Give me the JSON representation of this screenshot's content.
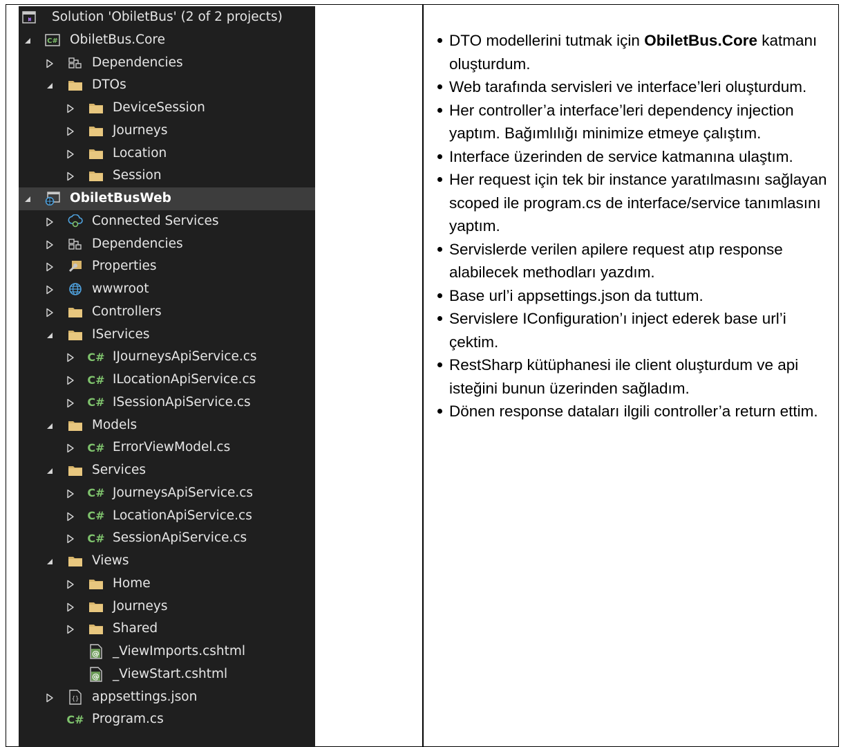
{
  "solution_explorer": {
    "items": [
      {
        "label": "Solution 'ObiletBus' (2 of 2 projects)",
        "icon": "solution-icon",
        "expand": "none"
      },
      {
        "label": "ObiletBus.Core",
        "icon": "csharp-project-icon",
        "expand": "expanded"
      },
      {
        "label": "Dependencies",
        "icon": "dependencies-icon",
        "expand": "collapsed"
      },
      {
        "label": "DTOs",
        "icon": "folder-icon",
        "expand": "expanded"
      },
      {
        "label": "DeviceSession",
        "icon": "folder-icon",
        "expand": "collapsed"
      },
      {
        "label": "Journeys",
        "icon": "folder-icon",
        "expand": "collapsed"
      },
      {
        "label": "Location",
        "icon": "folder-icon",
        "expand": "collapsed"
      },
      {
        "label": "Session",
        "icon": "folder-icon",
        "expand": "collapsed"
      },
      {
        "label": "ObiletBusWeb",
        "icon": "web-project-icon",
        "expand": "expanded",
        "selected": true
      },
      {
        "label": "Connected Services",
        "icon": "connected-services-icon",
        "expand": "collapsed"
      },
      {
        "label": "Dependencies",
        "icon": "dependencies-icon",
        "expand": "collapsed"
      },
      {
        "label": "Properties",
        "icon": "properties-icon",
        "expand": "collapsed"
      },
      {
        "label": "wwwroot",
        "icon": "globe-icon",
        "expand": "collapsed"
      },
      {
        "label": "Controllers",
        "icon": "folder-icon",
        "expand": "collapsed"
      },
      {
        "label": "IServices",
        "icon": "folder-icon",
        "expand": "expanded"
      },
      {
        "label": "IJourneysApiService.cs",
        "icon": "csharp-file-icon",
        "expand": "collapsed"
      },
      {
        "label": "ILocationApiService.cs",
        "icon": "csharp-file-icon",
        "expand": "collapsed"
      },
      {
        "label": "ISessionApiService.cs",
        "icon": "csharp-file-icon",
        "expand": "collapsed"
      },
      {
        "label": "Models",
        "icon": "folder-icon",
        "expand": "expanded"
      },
      {
        "label": "ErrorViewModel.cs",
        "icon": "csharp-file-icon",
        "expand": "collapsed"
      },
      {
        "label": "Services",
        "icon": "folder-icon",
        "expand": "expanded"
      },
      {
        "label": "JourneysApiService.cs",
        "icon": "csharp-file-icon",
        "expand": "collapsed"
      },
      {
        "label": "LocationApiService.cs",
        "icon": "csharp-file-icon",
        "expand": "collapsed"
      },
      {
        "label": "SessionApiService.cs",
        "icon": "csharp-file-icon",
        "expand": "collapsed"
      },
      {
        "label": "Views",
        "icon": "folder-icon",
        "expand": "expanded"
      },
      {
        "label": "Home",
        "icon": "folder-icon",
        "expand": "collapsed"
      },
      {
        "label": "Journeys",
        "icon": "folder-icon",
        "expand": "collapsed"
      },
      {
        "label": "Shared",
        "icon": "folder-icon",
        "expand": "collapsed"
      },
      {
        "label": "_ViewImports.cshtml",
        "icon": "razor-file-icon",
        "expand": "none"
      },
      {
        "label": "_ViewStart.cshtml",
        "icon": "razor-file-icon",
        "expand": "none"
      },
      {
        "label": "appsettings.json",
        "icon": "json-file-icon",
        "expand": "collapsed"
      },
      {
        "label": "Program.cs",
        "icon": "csharp-file-icon",
        "expand": "none"
      }
    ],
    "csharp_glyph": "C#"
  },
  "notes": {
    "items": [
      {
        "before": "DTO modellerini tutmak için ",
        "bold": "ObiletBus.Core",
        "after": " katmanı oluşturdum."
      },
      {
        "before": "Web tarafında servisleri ve interface’leri oluşturdum.",
        "bold": "",
        "after": ""
      },
      {
        "before": "Her controller’a interface’leri dependency injection yaptım. Bağımlılığı minimize etmeye çalıştım.",
        "bold": "",
        "after": ""
      },
      {
        "before": "Interface üzerinden de service katmanına ulaştım.",
        "bold": "",
        "after": ""
      },
      {
        "before": "Her request için tek bir instance yaratılmasını sağlayan scoped ile program.cs de interface/service tanımlasını yaptım.",
        "bold": "",
        "after": ""
      },
      {
        "before": "Servislerde verilen apilere request atıp response alabilecek methodları yazdım.",
        "bold": "",
        "after": ""
      },
      {
        "before": "Base url’i appsettings.json da tuttum.",
        "bold": "",
        "after": ""
      },
      {
        "before": "Servislere IConfiguration’ı inject ederek base url’i çektim.",
        "bold": "",
        "after": ""
      },
      {
        "before": "RestSharp kütüphanesi ile client oluşturdum ve api isteğini bunun üzerinden sağladım.",
        "bold": "",
        "after": ""
      },
      {
        "before": "Dönen response dataları ilgili controller’a return ettim.",
        "bold": "",
        "after": ""
      }
    ]
  },
  "colors": {
    "explorer_bg": "#1f1f1f",
    "explorer_text": "#e6e6e6",
    "selected_row": "#3d3d3d",
    "folder": "#d7b46a",
    "csharp": "#7fc36d"
  }
}
